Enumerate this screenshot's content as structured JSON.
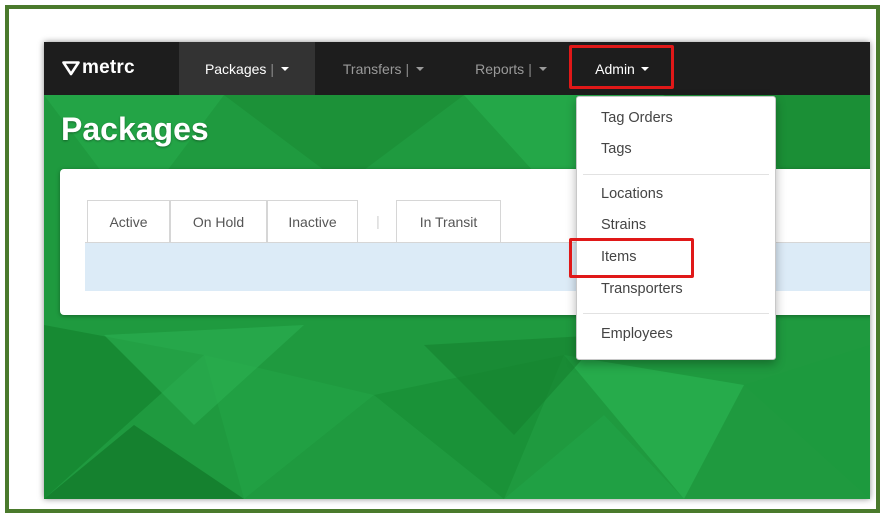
{
  "app": {
    "logo_text": "metrc"
  },
  "nav": {
    "packages": {
      "label": "Packages",
      "sep": "|"
    },
    "transfers": {
      "label": "Transfers",
      "sep": "|"
    },
    "reports": {
      "label": "Reports",
      "sep": "|"
    },
    "admin": {
      "label": "Admin"
    }
  },
  "page": {
    "title": "Packages"
  },
  "tabs": [
    {
      "label": "Active"
    },
    {
      "label": "On Hold"
    },
    {
      "label": "Inactive"
    },
    {
      "label": "In Transit"
    }
  ],
  "tab_separator": "|",
  "admin_menu": {
    "items": [
      {
        "label": "Tag Orders"
      },
      {
        "label": "Tags"
      },
      {
        "label": "Locations"
      },
      {
        "label": "Strains"
      },
      {
        "label": "Items"
      },
      {
        "label": "Transporters"
      },
      {
        "label": "Employees"
      }
    ]
  },
  "colors": {
    "navbar": "#1d1d1d",
    "background_green": "#1f9a3f",
    "highlight_red": "#e01818",
    "frame_green": "#4a7a2c",
    "tab_content": "#dcebf7"
  },
  "icons": {
    "logo": "metrc-logo-icon",
    "caret": "caret-down-icon"
  }
}
